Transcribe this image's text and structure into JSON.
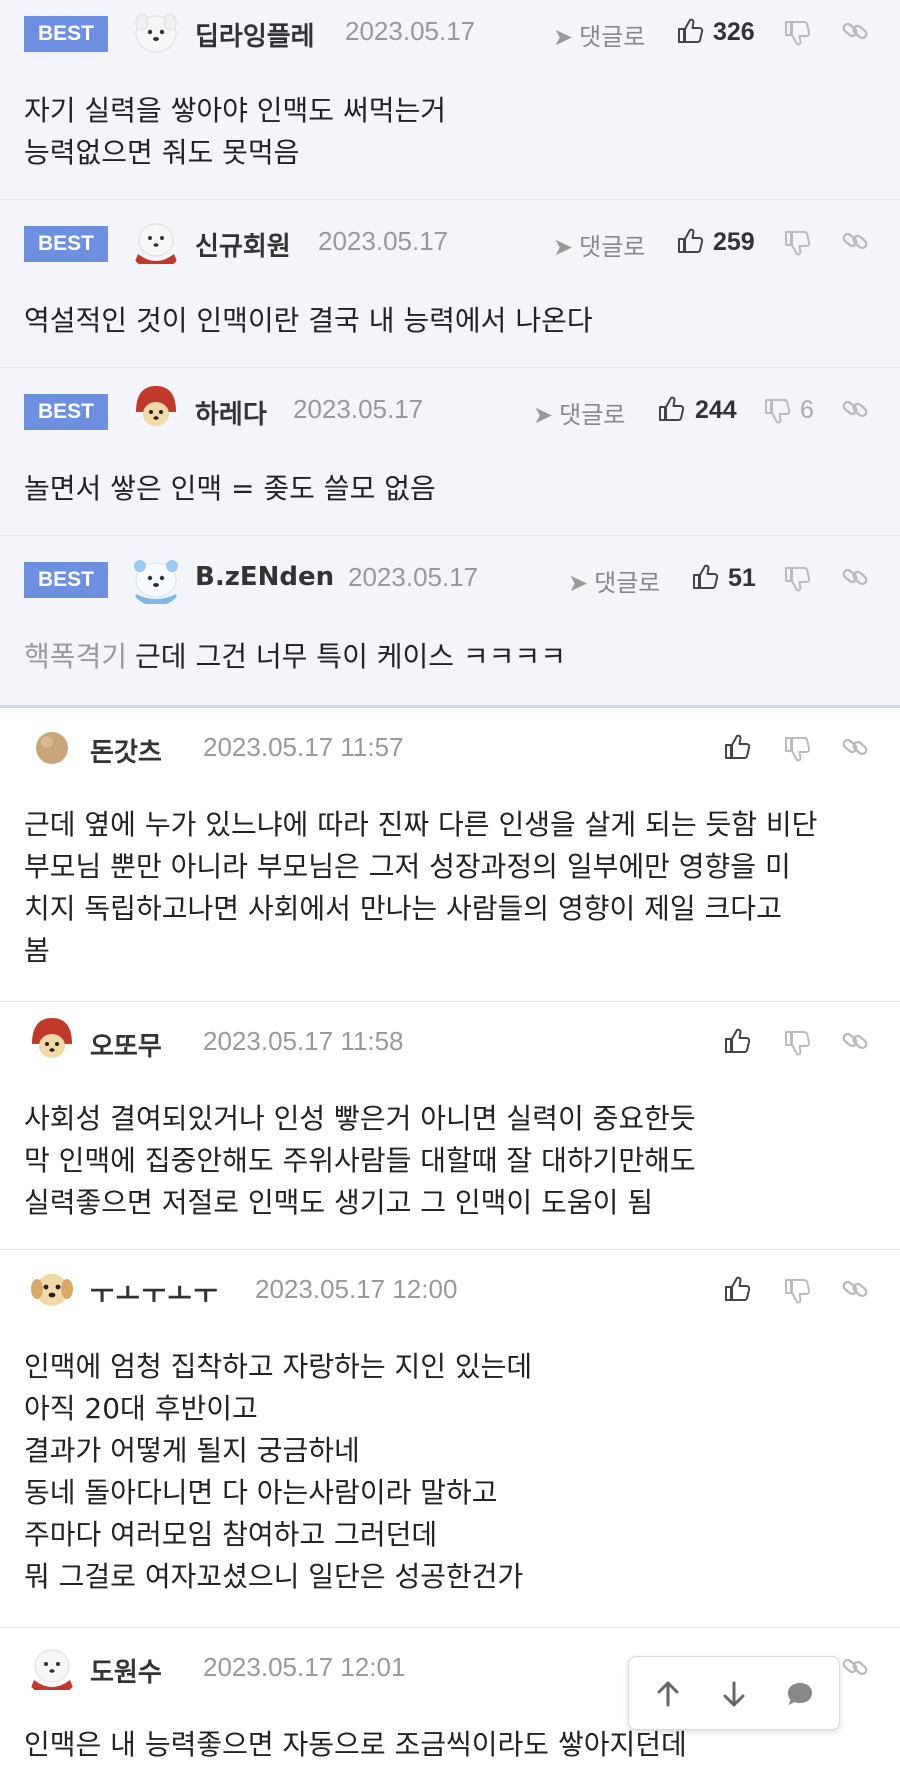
{
  "best_comments": [
    {
      "badge": "BEST",
      "nickname": "딥라잉플레",
      "date": "2023.05.17",
      "reply_label": "댓글로",
      "upvotes": "326",
      "downvotes": "",
      "lines": [
        "자기 실력을 쌓아야 인맥도 써먹는거",
        "능력없으면 줘도 못먹음"
      ]
    },
    {
      "badge": "BEST",
      "nickname": "신규회원",
      "date": "2023.05.17",
      "reply_label": "댓글로",
      "upvotes": "259",
      "downvotes": "",
      "lines": [
        "역설적인 것이 인맥이란 결국 내 능력에서 나온다"
      ]
    },
    {
      "badge": "BEST",
      "nickname": "하레다",
      "date": "2023.05.17",
      "reply_label": "댓글로",
      "upvotes": "244",
      "downvotes": "6",
      "lines": [
        "놀면서 쌓은 인맥 = 좆도 쓸모 없음"
      ]
    },
    {
      "badge": "BEST",
      "nickname": "B.zENden",
      "date": "2023.05.17",
      "reply_label": "댓글로",
      "upvotes": "51",
      "downvotes": "",
      "quote_tag": "핵폭격기",
      "lines": [
        "근데 그건 너무 특이 케이스 ㅋㅋㅋㅋ"
      ]
    }
  ],
  "comments": [
    {
      "nickname": "돈갓츠",
      "date": "2023.05.17 11:57",
      "lines": [
        "근데 옆에 누가 있느냐에 따라 진짜 다른 인생을 살게 되는 듯함 비단",
        "부모님 뿐만 아니라 부모님은 그저 성장과정의 일부에만 영향을 미",
        "치지 독립하고나면 사회에서 만나는 사람들의 영향이 제일 크다고",
        "봄"
      ]
    },
    {
      "nickname": "오또무",
      "date": "2023.05.17 11:58",
      "lines": [
        "사회성 결여되있거나 인성 빻은거 아니면 실력이 중요한듯",
        "막 인맥에 집중안해도 주위사람들 대할때 잘 대하기만해도",
        "실력좋으면 저절로 인맥도 생기고 그 인맥이 도움이 됨"
      ]
    },
    {
      "nickname": "ㅜㅗㅜㅗㅜ",
      "date": "2023.05.17 12:00",
      "lines": [
        "인맥에 엄청 집착하고 자랑하는 지인 있는데",
        "아직 20대 후반이고",
        "결과가 어떻게 될지 궁금하네",
        "동네 돌아다니면 다 아는사람이라 말하고",
        "주마다 여러모임 참여하고 그러던데",
        "뭐 그걸로 여자꼬셨으니 일단은 성공한건가"
      ]
    },
    {
      "nickname": "도원수",
      "date": "2023.05.17 12:01",
      "lines": [
        "인맥은 내 능력좋으면 자동으로 조금씩이라도 쌓아지던데"
      ]
    }
  ],
  "icons": {
    "upvote": "thumbs-up-icon",
    "downvote": "thumbs-down-icon",
    "link": "link-icon",
    "reply": "reply-arrow-icon",
    "scroll_up": "arrow-up-icon",
    "scroll_down": "arrow-down-icon",
    "comment": "speech-bubble-icon"
  },
  "colors": {
    "best_badge": "#6d8fe0",
    "best_background": "#f3f5fa",
    "date_text": "#999999"
  }
}
